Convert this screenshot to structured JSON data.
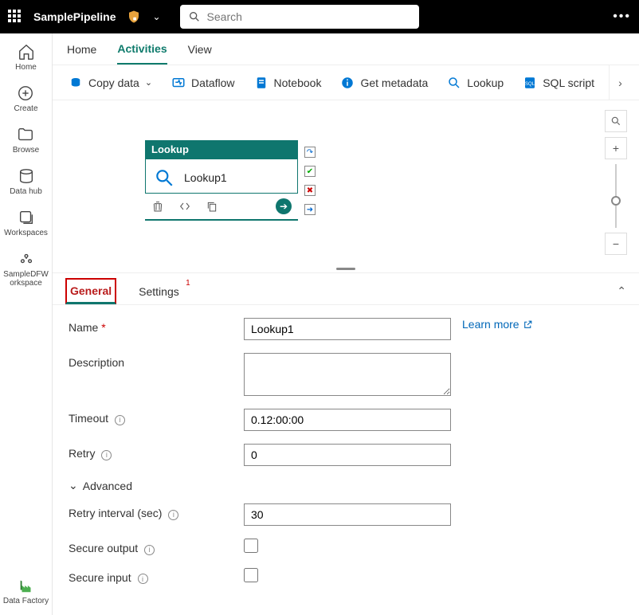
{
  "header": {
    "app_title": "SamplePipeline",
    "search_placeholder": "Search"
  },
  "leftnav": {
    "items": [
      {
        "label": "Home",
        "icon": "home-icon"
      },
      {
        "label": "Create",
        "icon": "plus-circle-icon"
      },
      {
        "label": "Browse",
        "icon": "folder-icon"
      },
      {
        "label": "Data hub",
        "icon": "database-icon"
      },
      {
        "label": "Workspaces",
        "icon": "stack-icon"
      },
      {
        "label": "SampleDFWorkspace",
        "icon": "workspace-icon"
      }
    ],
    "bottom_label": "Data Factory"
  },
  "tabs": {
    "items": [
      {
        "label": "Home"
      },
      {
        "label": "Activities"
      },
      {
        "label": "View"
      }
    ],
    "active_index": 1
  },
  "toolbar": {
    "items": [
      {
        "label": "Copy data",
        "icon": "copy-data-icon",
        "has_dropdown": true
      },
      {
        "label": "Dataflow",
        "icon": "dataflow-icon"
      },
      {
        "label": "Notebook",
        "icon": "notebook-icon"
      },
      {
        "label": "Get metadata",
        "icon": "info-icon"
      },
      {
        "label": "Lookup",
        "icon": "lookup-icon"
      },
      {
        "label": "SQL script",
        "icon": "sql-icon"
      }
    ]
  },
  "node": {
    "type_label": "Lookup",
    "name": "Lookup1"
  },
  "panel": {
    "tabs": [
      {
        "label": "General"
      },
      {
        "label": "Settings",
        "badge": "1"
      }
    ],
    "active_index": 0,
    "fields": {
      "name_label": "Name",
      "name_value": "Lookup1",
      "learn_more": "Learn more",
      "description_label": "Description",
      "description_value": "",
      "timeout_label": "Timeout",
      "timeout_value": "0.12:00:00",
      "retry_label": "Retry",
      "retry_value": "0",
      "advanced_label": "Advanced",
      "retry_interval_label": "Retry interval (sec)",
      "retry_interval_value": "30",
      "secure_output_label": "Secure output",
      "secure_output_value": false,
      "secure_input_label": "Secure input",
      "secure_input_value": false
    }
  }
}
